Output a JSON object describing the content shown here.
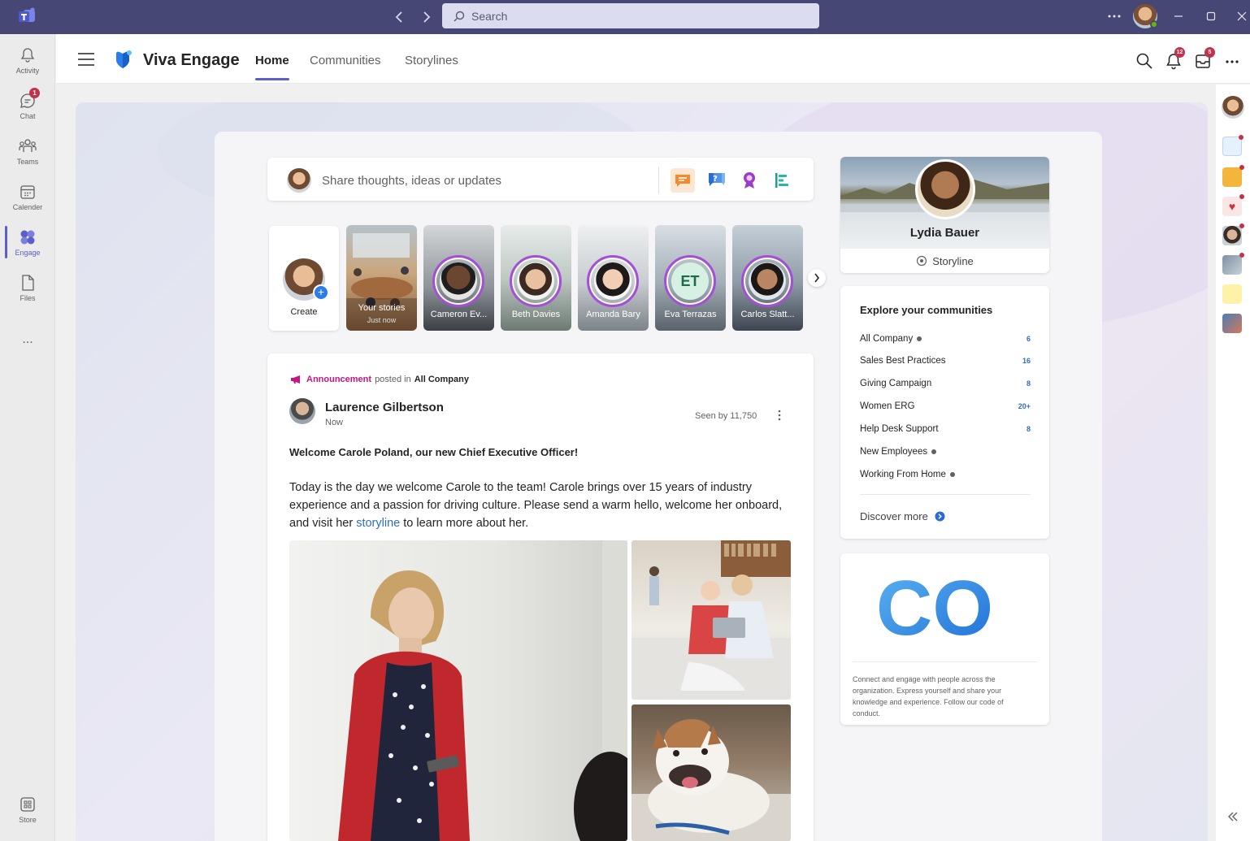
{
  "titlebar": {
    "search_placeholder": "Search"
  },
  "rail": {
    "items": [
      {
        "label": "Activity",
        "icon": "bell-icon"
      },
      {
        "label": "Chat",
        "icon": "chat-icon",
        "badge": "1"
      },
      {
        "label": "Teams",
        "icon": "teams-icon"
      },
      {
        "label": "Calender",
        "icon": "calendar-icon"
      },
      {
        "label": "Engage",
        "icon": "engage-icon",
        "active": true
      },
      {
        "label": "Files",
        "icon": "file-icon"
      }
    ],
    "more": "...",
    "store_label": "Store"
  },
  "app": {
    "title": "Viva Engage",
    "tabs": [
      {
        "label": "Home",
        "active": true
      },
      {
        "label": "Communities"
      },
      {
        "label": "Storylines"
      }
    ],
    "notif_badge": "12",
    "inbox_badge": "5"
  },
  "composer": {
    "placeholder": "Share thoughts, ideas or updates",
    "icons": [
      "discussion-icon",
      "question-icon",
      "praise-icon",
      "poll-icon"
    ]
  },
  "stories": {
    "create_label": "Create",
    "your_stories": {
      "label": "Your stories",
      "sub": "Just now"
    },
    "people": [
      {
        "name": "Cameron Ev..."
      },
      {
        "name": "Beth Davies"
      },
      {
        "name": "Amanda Bary"
      },
      {
        "name": "Eva Terrazas",
        "initials": "ET"
      },
      {
        "name": "Carlos Slatt..."
      }
    ]
  },
  "post": {
    "type_label": "Announcement",
    "posted_in_label": "posted in",
    "community": "All Company",
    "author": "Laurence Gilbertson",
    "time": "Now",
    "seen": "Seen by 11,750",
    "title": "Welcome Carole Poland, our new Chief Executive Officer!",
    "body_before_link": "Today is the day we welcome Carole to the team! Carole brings over 15 years of industry experience and a passion for driving culture. Please send a warm hello, welcome her onboard, and visit her ",
    "body_link": "storyline",
    "body_after_link": " to learn more about her."
  },
  "profile": {
    "name": "Lydia Bauer",
    "storyline_label": "Storyline"
  },
  "communities": {
    "title": "Explore your communities",
    "items": [
      {
        "name": "All Company",
        "count": "6",
        "dot": true
      },
      {
        "name": "Sales Best Practices",
        "count": "16"
      },
      {
        "name": "Giving Campaign",
        "count": "8"
      },
      {
        "name": "Women ERG",
        "count": "20+"
      },
      {
        "name": "Help Desk Support",
        "count": "8"
      },
      {
        "name": "New Employees",
        "dot": true
      },
      {
        "name": "Working From Home",
        "dot": true
      }
    ],
    "discover_label": "Discover more"
  },
  "co_card": {
    "logo_text": "CO",
    "description": "Connect and engage with people across the organization. Express yourself and share your knowledge and experience. Follow our code of conduct."
  },
  "colors": {
    "teams_purple": "#464775",
    "accent": "#5b5fc7",
    "announcement": "#c5157f",
    "link": "#2f6fbe"
  }
}
